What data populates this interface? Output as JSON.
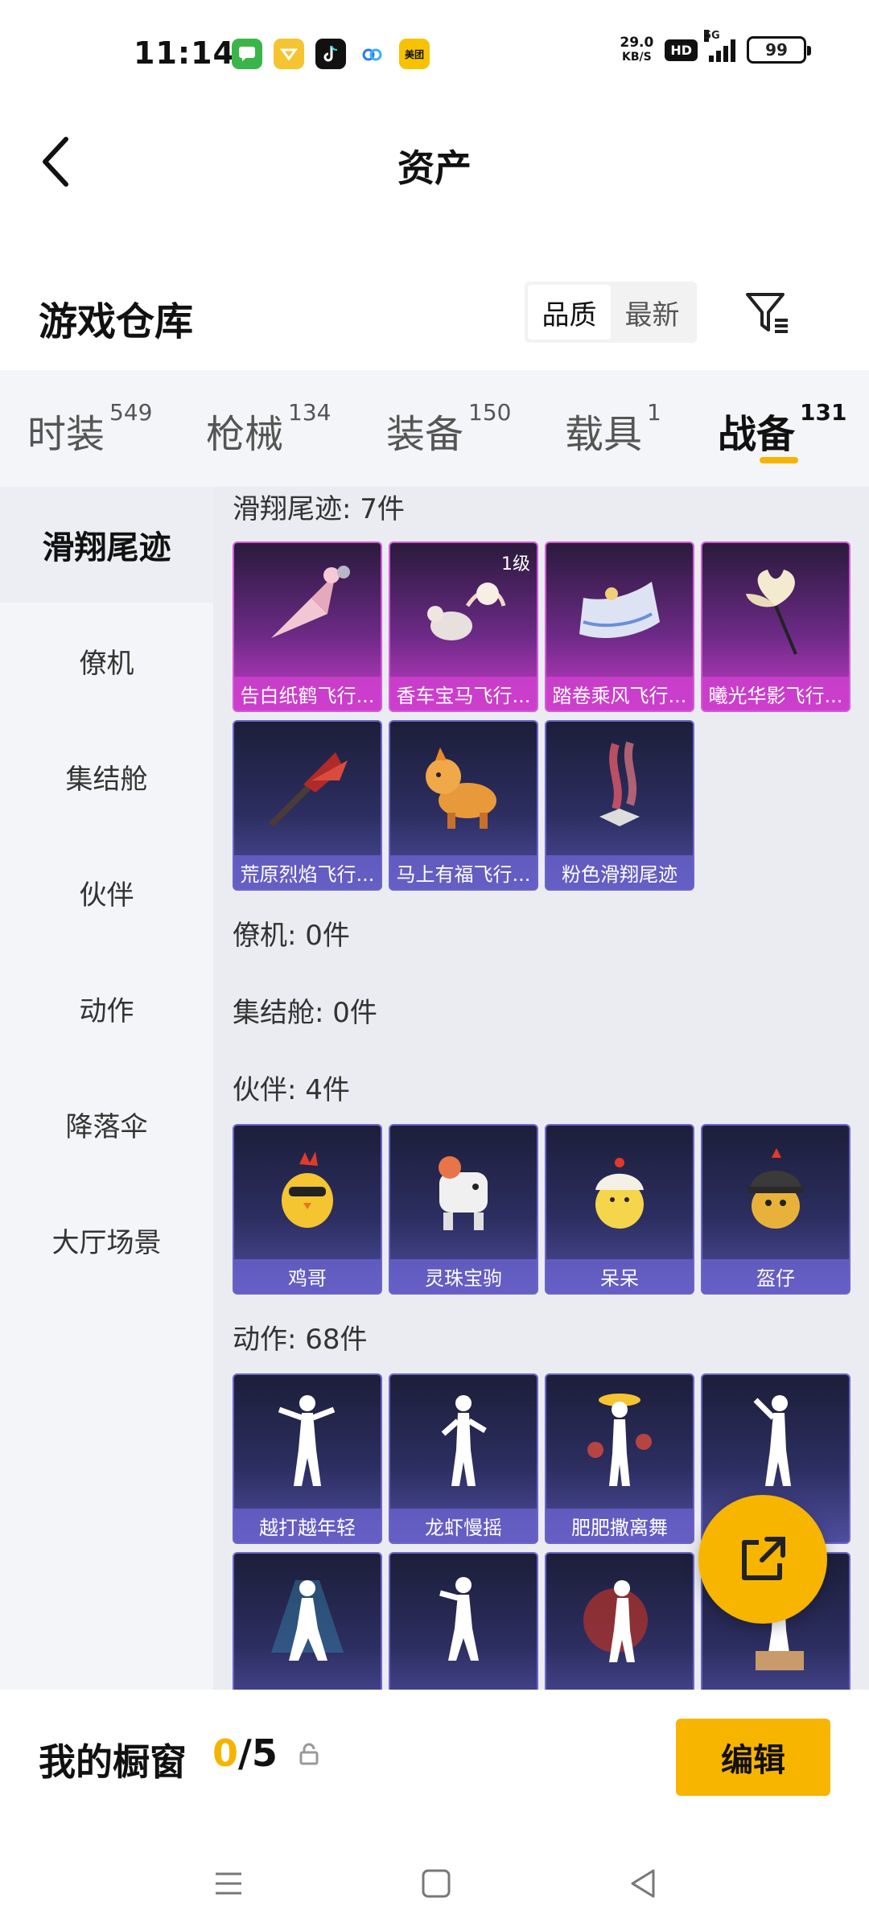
{
  "status_bar": {
    "time": "11:14",
    "net_speed_value": "29.0",
    "net_speed_unit": "KB/S",
    "hd": "HD",
    "network": "5G",
    "battery": "99",
    "apps": [
      "messages-icon",
      "wallet-icon",
      "tiktok-icon",
      "cloud-icon",
      "meituan-icon"
    ],
    "meituan_label": "美团"
  },
  "header": {
    "title": "资产"
  },
  "warehouse": {
    "title": "游戏仓库",
    "sort_options": [
      "品质",
      "最新"
    ],
    "active_sort": "品质"
  },
  "tabs": [
    {
      "label": "时装",
      "count": "549"
    },
    {
      "label": "枪械",
      "count": "134"
    },
    {
      "label": "装备",
      "count": "150"
    },
    {
      "label": "载具",
      "count": "1"
    },
    {
      "label": "战备",
      "count": "131"
    }
  ],
  "sidebar": {
    "items": [
      "滑翔尾迹",
      "僚机",
      "集结舱",
      "伙伴",
      "动作",
      "降落伞",
      "大厅场景"
    ]
  },
  "sections": {
    "glide": {
      "title": "滑翔尾迹: 7件",
      "items": [
        {
          "label": "告白纸鹤飞行...",
          "tier": "purple"
        },
        {
          "label": "香车宝马飞行...",
          "tier": "purple",
          "level": "1级"
        },
        {
          "label": "踏卷乘风飞行...",
          "tier": "purple"
        },
        {
          "label": "曦光华影飞行...",
          "tier": "purple"
        },
        {
          "label": "荒原烈焰飞行...",
          "tier": "blue"
        },
        {
          "label": "马上有福飞行...",
          "tier": "blue"
        },
        {
          "label": "粉色滑翔尾迹",
          "tier": "blue"
        }
      ]
    },
    "wingman": {
      "title": "僚机: 0件"
    },
    "assembly": {
      "title": "集结舱: 0件"
    },
    "partner": {
      "title": "伙伴: 4件",
      "items": [
        {
          "label": "鸡哥",
          "tier": "blue"
        },
        {
          "label": "灵珠宝驹",
          "tier": "blue"
        },
        {
          "label": "呆呆",
          "tier": "blue"
        },
        {
          "label": "盔仔",
          "tier": "blue"
        }
      ]
    },
    "emote": {
      "title": "动作: 68件",
      "items": [
        {
          "label": "越打越年轻",
          "tier": "blue"
        },
        {
          "label": "龙虾慢摇",
          "tier": "blue"
        },
        {
          "label": "肥肥撒离舞",
          "tier": "blue"
        },
        {
          "label": "",
          "tier": "blue"
        }
      ]
    }
  },
  "showcase": {
    "title": "我的橱窗",
    "current": "0",
    "total": "/5",
    "edit_label": "编辑"
  },
  "colors": {
    "accent": "#f7b500",
    "purple_tier": "#c83cc8",
    "blue_tier": "#4f4ea0"
  }
}
